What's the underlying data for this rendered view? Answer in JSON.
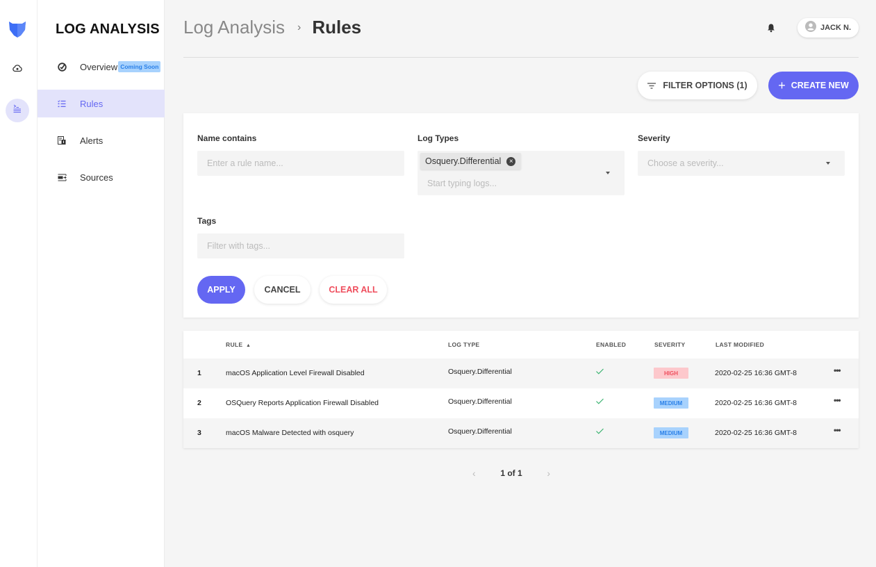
{
  "app": {
    "section_title": "LOG ANALYSIS"
  },
  "rail": {
    "items": [
      {
        "icon": "cloud-eye-icon"
      },
      {
        "icon": "terminal-list-icon",
        "active": true
      }
    ]
  },
  "sidebar": {
    "items": [
      {
        "label": "Overview",
        "icon": "gauge-check-icon",
        "badge": "Coming Soon"
      },
      {
        "label": "Rules",
        "icon": "checklist-icon",
        "active": true
      },
      {
        "label": "Alerts",
        "icon": "alert-doc-icon"
      },
      {
        "label": "Sources",
        "icon": "source-input-icon"
      }
    ]
  },
  "header": {
    "breadcrumb": [
      "Log Analysis",
      "Rules"
    ],
    "breadcrumb_sep": "›",
    "user_name": "JACK N."
  },
  "toolbar": {
    "filter_label": "FILTER OPTIONS (1)",
    "create_label": "CREATE NEW"
  },
  "filters": {
    "name": {
      "label": "Name contains",
      "placeholder": "Enter a rule name...",
      "value": ""
    },
    "log_types": {
      "label": "Log Types",
      "selected": [
        "Osquery.Differential"
      ],
      "placeholder": "Start typing logs..."
    },
    "severity": {
      "label": "Severity",
      "placeholder": "Choose a severity...",
      "value": ""
    },
    "tags": {
      "label": "Tags",
      "placeholder": "Filter with tags...",
      "value": ""
    },
    "apply_label": "APPLY",
    "cancel_label": "CANCEL",
    "clear_label": "CLEAR ALL"
  },
  "table": {
    "headers": {
      "rule": "RULE",
      "log_type": "LOG TYPE",
      "enabled": "ENABLED",
      "severity": "SEVERITY",
      "last_modified": "LAST MODIFIED"
    },
    "sort": {
      "column": "rule",
      "direction": "asc"
    },
    "rows": [
      {
        "index": "1",
        "rule": "macOS Application Level Firewall Disabled",
        "log_type": "Osquery.Differential",
        "enabled": true,
        "severity": "HIGH",
        "last_modified": "2020-02-25 16:36 GMT-8"
      },
      {
        "index": "2",
        "rule": "OSQuery Reports Application Firewall Disabled",
        "log_type": "Osquery.Differential",
        "enabled": true,
        "severity": "MEDIUM",
        "last_modified": "2020-02-25 16:36 GMT-8"
      },
      {
        "index": "3",
        "rule": "macOS Malware Detected with osquery",
        "log_type": "Osquery.Differential",
        "enabled": true,
        "severity": "MEDIUM",
        "last_modified": "2020-02-25 16:36 GMT-8"
      }
    ]
  },
  "pagination": {
    "text": "1 of 1",
    "current": 1,
    "total": 1
  },
  "colors": {
    "accent": "#6467f2",
    "high": "#ef4e5d",
    "medium": "#2a80e8",
    "enabled": "#3cb371"
  }
}
